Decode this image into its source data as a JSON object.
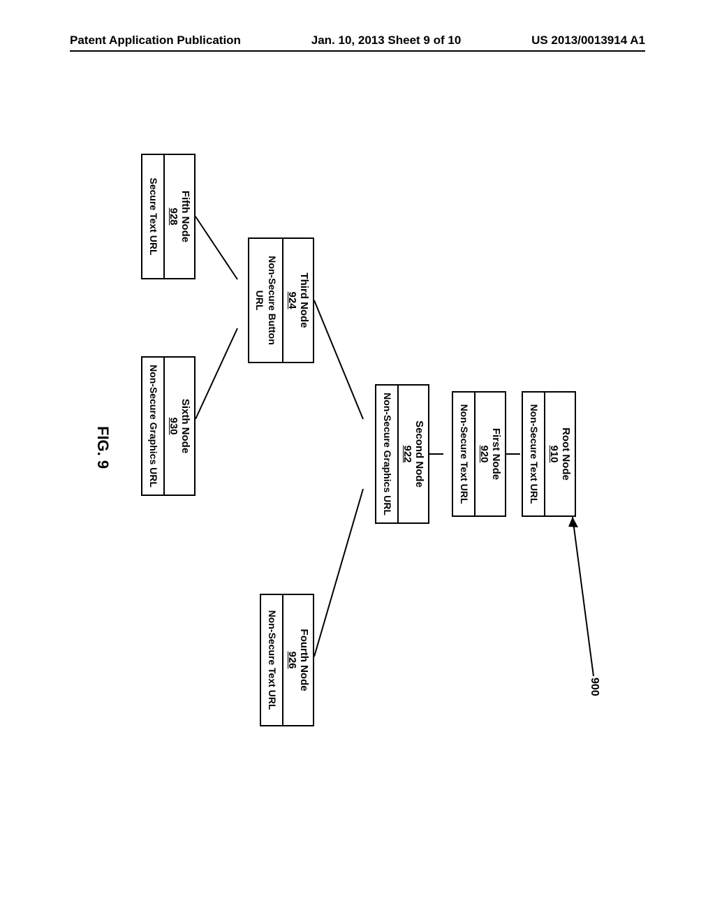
{
  "header": {
    "left": "Patent Application Publication",
    "center": "Jan. 10, 2013  Sheet 9 of 10",
    "right": "US 2013/0013914 A1"
  },
  "system_ref": "900",
  "figure_label": "FIG. 9",
  "nodes": {
    "root": {
      "title": "Root Node",
      "ref": "910",
      "sub": "Non-Secure Text URL"
    },
    "first": {
      "title": "First Node",
      "ref": "920",
      "sub": "Non-Secure Text URL"
    },
    "second": {
      "title": "Second Node",
      "ref": "922",
      "sub": "Non-Secure Graphics URL"
    },
    "third": {
      "title": "Third Node",
      "ref": "924",
      "sub": "Non-Secure Button URL"
    },
    "fourth": {
      "title": "Fourth Node",
      "ref": "926",
      "sub": "Non-Secure Text URL"
    },
    "fifth": {
      "title": "Fifth Node",
      "ref": "928",
      "sub": "Secure Text URL"
    },
    "sixth": {
      "title": "Sixth Node",
      "ref": "930",
      "sub": "Non-Secure Graphics URL"
    }
  }
}
